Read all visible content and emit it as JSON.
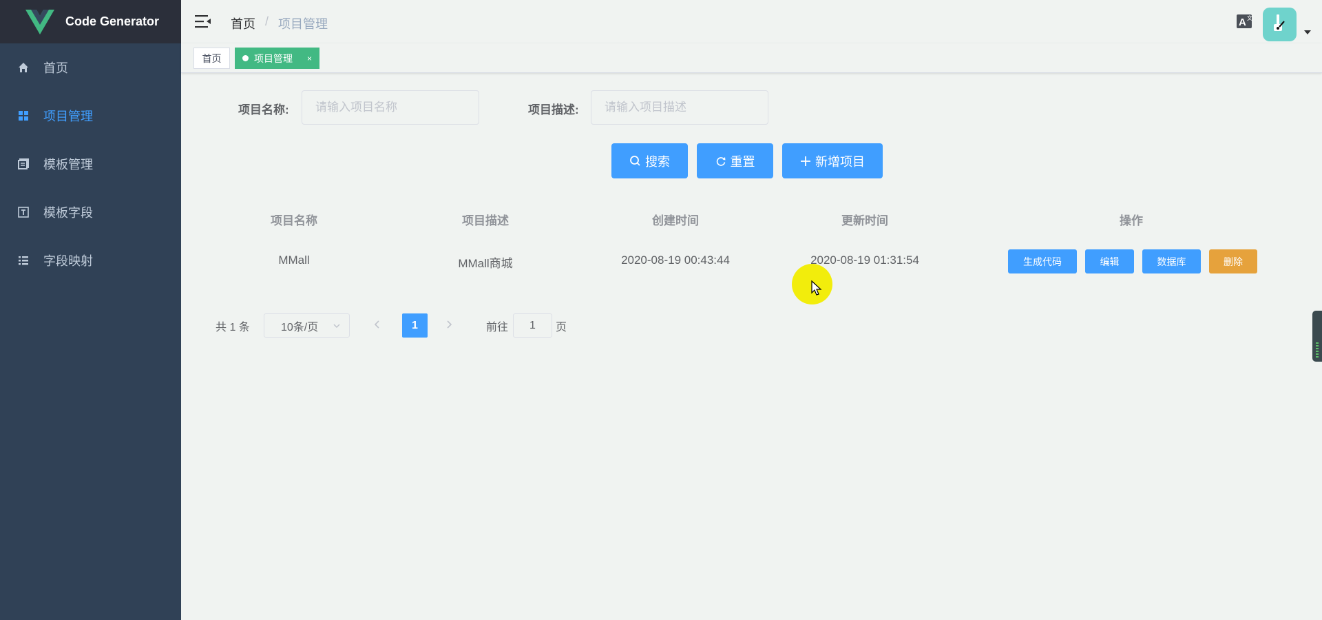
{
  "app": {
    "title": "Code Generator"
  },
  "sidebar": {
    "items": [
      {
        "label": "首页",
        "icon": "home-icon",
        "active": false
      },
      {
        "label": "项目管理",
        "icon": "grid-icon",
        "active": true
      },
      {
        "label": "模板管理",
        "icon": "documents-icon",
        "active": false
      },
      {
        "label": "模板字段",
        "icon": "text-box-icon",
        "active": false
      },
      {
        "label": "字段映射",
        "icon": "list-icon",
        "active": false
      }
    ]
  },
  "header": {
    "breadcrumb": {
      "home": "首页",
      "separator": "/",
      "current": "项目管理"
    }
  },
  "tags": {
    "home": "首页",
    "active": "项目管理",
    "close": "×"
  },
  "search": {
    "name_label": "项目名称:",
    "name_placeholder": "请输入项目名称",
    "desc_label": "项目描述:",
    "desc_placeholder": "请输入项目描述",
    "search_button": "搜索",
    "reset_button": "重置",
    "add_button": "新增项目"
  },
  "table": {
    "headers": [
      "项目名称",
      "项目描述",
      "创建时间",
      "更新时间",
      "操作"
    ],
    "rows": [
      {
        "name": "MMall",
        "description": "MMall商城",
        "created": "2020-08-19 00:43:44",
        "updated": "2020-08-19 01:31:54",
        "actions": [
          "生成代码",
          "编辑",
          "数据库",
          "删除"
        ]
      }
    ]
  },
  "pagination": {
    "total": "共 1 条",
    "page_size": "10条/页",
    "current_page": "1",
    "goto_label": "前往",
    "goto_value": "1",
    "page_suffix": "页"
  },
  "colors": {
    "sidebar_bg": "#304156",
    "logo_bg": "#2b2f3a",
    "primary": "#409eff",
    "warning": "#e6a23c",
    "tag_active": "#42b983",
    "page_bg": "#f0f3f1"
  }
}
